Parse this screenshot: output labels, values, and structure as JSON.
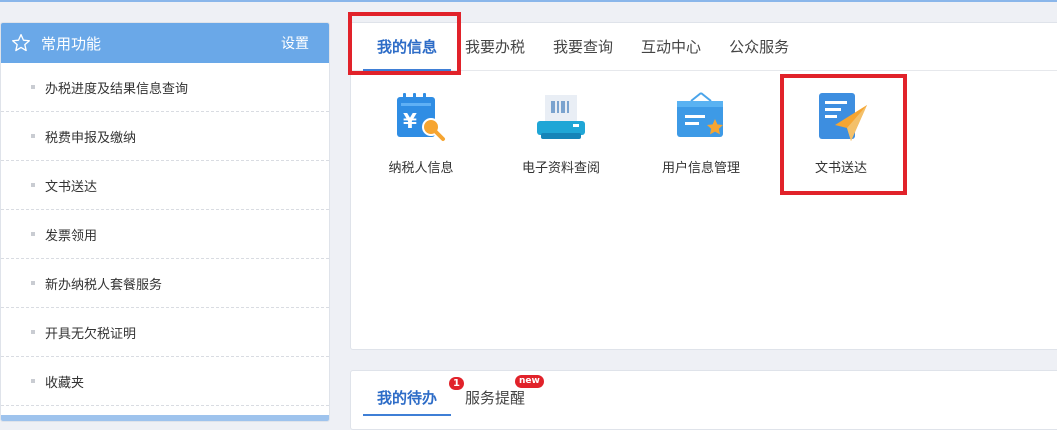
{
  "sidebar": {
    "title": "常用功能",
    "settings_label": "设置",
    "items": [
      {
        "label": "办税进度及结果信息查询"
      },
      {
        "label": "税费申报及缴纳"
      },
      {
        "label": "文书送达"
      },
      {
        "label": "发票领用"
      },
      {
        "label": "新办纳税人套餐服务"
      },
      {
        "label": "开具无欠税证明"
      },
      {
        "label": "收藏夹"
      }
    ]
  },
  "main": {
    "tabs": [
      {
        "label": "我的信息",
        "active": true
      },
      {
        "label": "我要办税"
      },
      {
        "label": "我要查询"
      },
      {
        "label": "互动中心"
      },
      {
        "label": "公众服务"
      }
    ],
    "apps": [
      {
        "label": "纳税人信息",
        "icon": "taxpayer-info-icon"
      },
      {
        "label": "电子资料查阅",
        "icon": "e-document-printer-icon"
      },
      {
        "label": "用户信息管理",
        "icon": "user-info-folder-icon"
      },
      {
        "label": "文书送达",
        "icon": "document-send-icon"
      }
    ]
  },
  "bottom": {
    "tabs": [
      {
        "label": "我的待办",
        "active": true,
        "badge": "1"
      },
      {
        "label": "服务提醒",
        "badge": "new"
      }
    ]
  },
  "colors": {
    "accent": "#3f7fd6",
    "sidebar_header": "#6aa8e8",
    "highlight": "#e1222a",
    "badge": "#e1222a"
  }
}
